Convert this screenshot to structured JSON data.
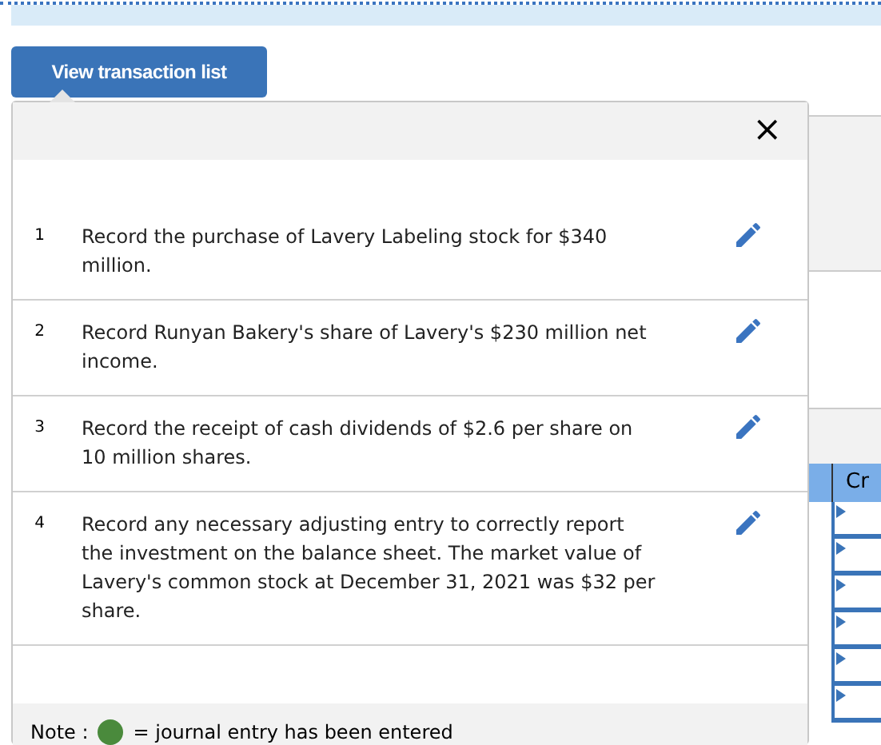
{
  "view_button": {
    "label": "View transaction list"
  },
  "popup": {
    "close": "×",
    "transactions": [
      {
        "number": "1",
        "text": "Record the purchase of Lavery Labeling stock for $340 million."
      },
      {
        "number": "2",
        "text": "Record Runyan Bakery's share of Lavery's $230 million net income."
      },
      {
        "number": "3",
        "text": "Record the receipt of cash dividends of $2.6 per share on 10 million shares."
      },
      {
        "number": "4",
        "text": "Record any necessary adjusting entry to correctly report the investment on the balance sheet. The market value of Lavery's common stock at December 31, 2021 was $32 per share."
      }
    ],
    "note": {
      "prefix": "Note :",
      "suffix": "= journal entry has been entered"
    }
  },
  "background_table": {
    "column_1": "Cr"
  }
}
